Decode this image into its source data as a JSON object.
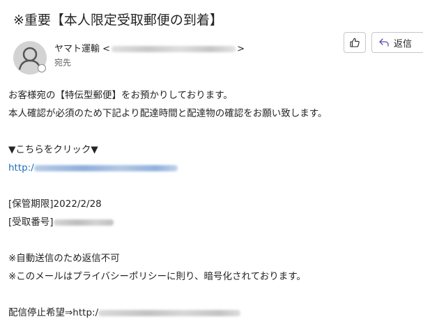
{
  "email": {
    "subject": "※重要【本人限定受取郵便の到着】",
    "sender": {
      "name": "ヤマト運輸",
      "address_open": "<",
      "address_close": ">"
    },
    "recipient_label": "宛先",
    "actions": {
      "reply_label": "返信"
    },
    "body": {
      "line1": "お客様宛の【特伝型郵便】をお預かりしております。",
      "line2": "本人確認が必須のため下記より配達時間と配達物の確認をお願い致します。",
      "cta": "▼こちらをクリック▼",
      "link_prefix": "http:/",
      "storage_label": "[保管期限]",
      "storage_value": "2022/2/28",
      "receipt_label": "[受取番号]",
      "notice1": "※自動送信のため返信不可",
      "notice2": "※このメールはプライバシーポリシーに則り、暗号化されております。",
      "unsubscribe_prefix": "配信停止希望⇒http:/"
    }
  },
  "colors": {
    "link": "#1e6fb8",
    "text": "#242424",
    "secondary_text": "#616161",
    "avatar_bg": "#d3d3d3",
    "button_border": "#c7c7c7"
  },
  "icons": {
    "avatar": "person-silhouette-icon",
    "presence": "status-offline-icon",
    "like": "thumbs-up-icon",
    "reply": "reply-arrow-icon"
  }
}
